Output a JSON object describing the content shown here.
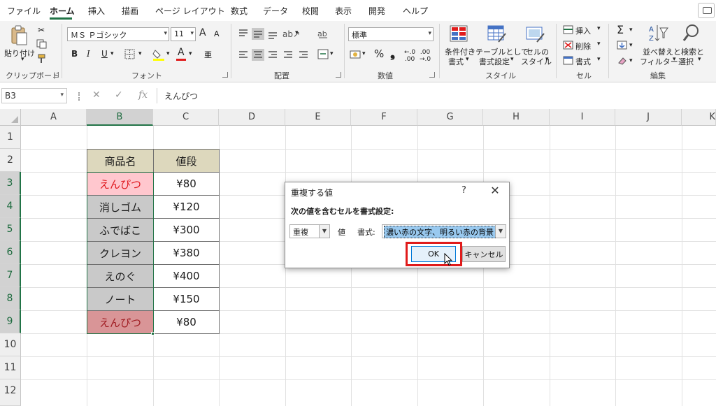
{
  "menu": {
    "items": [
      "ファイル",
      "ホーム",
      "挿入",
      "描画",
      "ページ レイアウト",
      "数式",
      "データ",
      "校閲",
      "表示",
      "開発",
      "ヘルプ"
    ],
    "active_index": 1
  },
  "ribbon": {
    "clipboard": {
      "paste": "貼り付け",
      "label": "クリップボード"
    },
    "font": {
      "name": "ＭＳ Ｐゴシック",
      "size": "11",
      "bold": "B",
      "italic": "I",
      "underline": "U",
      "grow": "A",
      "shrink": "A",
      "color_letter": "A",
      "label": "フォント"
    },
    "alignment": {
      "label": "配置"
    },
    "number": {
      "format": "標準",
      "percent": "%",
      "comma": "❟",
      "label": "数値"
    },
    "styles": {
      "conditional": "条件付き",
      "conditional2": "書式",
      "table": "テーブルとして",
      "table2": "書式設定",
      "cell": "セルの",
      "cell2": "スタイル",
      "label": "スタイル"
    },
    "cells": {
      "insert": "挿入",
      "delete": "削除",
      "format": "書式",
      "label": "セル"
    },
    "editing": {
      "sort": "並べ替えと",
      "sort2": "フィルター",
      "find": "検索と",
      "find2": "選択",
      "label": "編集"
    }
  },
  "formula_bar": {
    "name_box": "B3",
    "formula": "えんぴつ"
  },
  "columns": [
    "A",
    "B",
    "C",
    "D",
    "E",
    "F",
    "G",
    "H",
    "I",
    "J",
    "K"
  ],
  "rows": [
    "1",
    "2",
    "3",
    "4",
    "5",
    "6",
    "7",
    "8",
    "9",
    "10",
    "11",
    "12"
  ],
  "table": {
    "headers": [
      "商品名",
      "値段"
    ],
    "rows": [
      {
        "name": "えんぴつ",
        "price": "¥80"
      },
      {
        "name": "消しゴム",
        "price": "¥120"
      },
      {
        "name": "ふでばこ",
        "price": "¥300"
      },
      {
        "name": "クレヨン",
        "price": "¥380"
      },
      {
        "name": "えのぐ",
        "price": "¥400"
      },
      {
        "name": "ノート",
        "price": "¥150"
      },
      {
        "name": "えんぴつ",
        "price": "¥80"
      }
    ]
  },
  "dialog": {
    "title": "重複する値",
    "help": "?",
    "close": "✕",
    "prompt": "次の値を含むセルを書式設定:",
    "type_value": "重複",
    "value_label": "値",
    "format_label": "書式:",
    "format_value": "濃い赤の文字、明るい赤の背景",
    "ok": "OK",
    "cancel": "キャンセル"
  },
  "colors": {
    "accent": "#217346",
    "duplicate_light_bg": "#ffc7ce",
    "duplicate_dark_bg": "#d99597",
    "highlight": "#e01b1b"
  }
}
